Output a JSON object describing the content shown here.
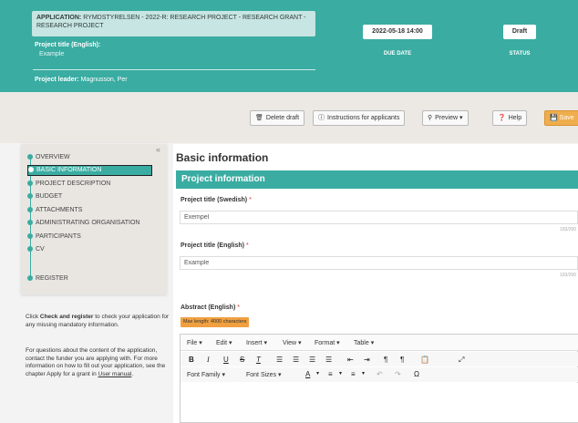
{
  "header": {
    "application_label": "APPLICATION:",
    "application_value": "RYMDSTYRELSEN - 2022-R: RESEARCH PROJECT - RESEARCH GRANT - RESEARCH PROJECT",
    "project_title_label": "Project title (English):",
    "project_title_value": "Example",
    "project_leader_label": "Project leader:",
    "project_leader_value": "Magnusson, Per",
    "due_date": "2022-05-18 14:00",
    "due_date_label": "DUE DATE",
    "status": "Draft",
    "status_label": "STATUS"
  },
  "toolbar": {
    "delete_label": "Delete draft",
    "instructions_label": "Instructions for applicants",
    "preview_label": "Preview",
    "help_label": "Help",
    "save_label": "Save"
  },
  "sidebar": {
    "collapse_glyph": "«",
    "items": [
      {
        "label": "OVERVIEW"
      },
      {
        "label": "BASIC INFORMATION"
      },
      {
        "label": "PROJECT DESCRIPTION"
      },
      {
        "label": "BUDGET"
      },
      {
        "label": "ATTACHMENTS"
      },
      {
        "label": "ADMINISTRATING ORGANISATION"
      },
      {
        "label": "PARTICIPANTS"
      },
      {
        "label": "CV"
      },
      {
        "label": "REGISTER"
      }
    ],
    "help1_a": "Click ",
    "help1_b": "Check and register",
    "help1_c": " to check your application for any missing mandatory information.",
    "help2_a": "For questions about the content of the application, contact the funder you are applying with. For more information on how to fill out your application, see the chapter Apply for a grant in ",
    "help2_link": "User manual",
    "help2_c": "."
  },
  "main": {
    "page_title": "Basic information",
    "section_title": "Project information",
    "title_sv_label": "Project title (Swedish)",
    "title_sv_value": "Exempel",
    "title_sv_counter": "193/200",
    "title_en_label": "Project title (English)",
    "title_en_value": "Example",
    "title_en_counter": "193/200",
    "abstract_label": "Abstract (English)",
    "abstract_maxlength": "Max length: 4000 characters",
    "required_mark": "*"
  },
  "editor": {
    "menus": [
      "File",
      "Edit",
      "Insert",
      "View",
      "Format",
      "Table"
    ],
    "font_family": "Font Family",
    "font_sizes": "Font Sizes"
  },
  "colors": {
    "brand_teal": "#3aaca2",
    "save_orange": "#f0ad4e",
    "badge_orange": "#f0a040"
  }
}
